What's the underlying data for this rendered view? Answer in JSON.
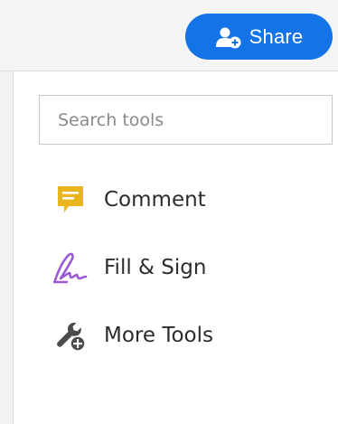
{
  "toolbar": {
    "share_label": "Share",
    "share_icon": "add-user-icon",
    "share_color": "#1473e6"
  },
  "search": {
    "placeholder": "Search tools",
    "value": ""
  },
  "tools": [
    {
      "label": "Comment",
      "icon": "comment-icon",
      "color": "#e8b51c"
    },
    {
      "label": "Fill & Sign",
      "icon": "signature-pen-icon",
      "color": "#9b59d6"
    },
    {
      "label": "More Tools",
      "icon": "wrench-add-icon",
      "color": "#4b4b4b"
    }
  ]
}
